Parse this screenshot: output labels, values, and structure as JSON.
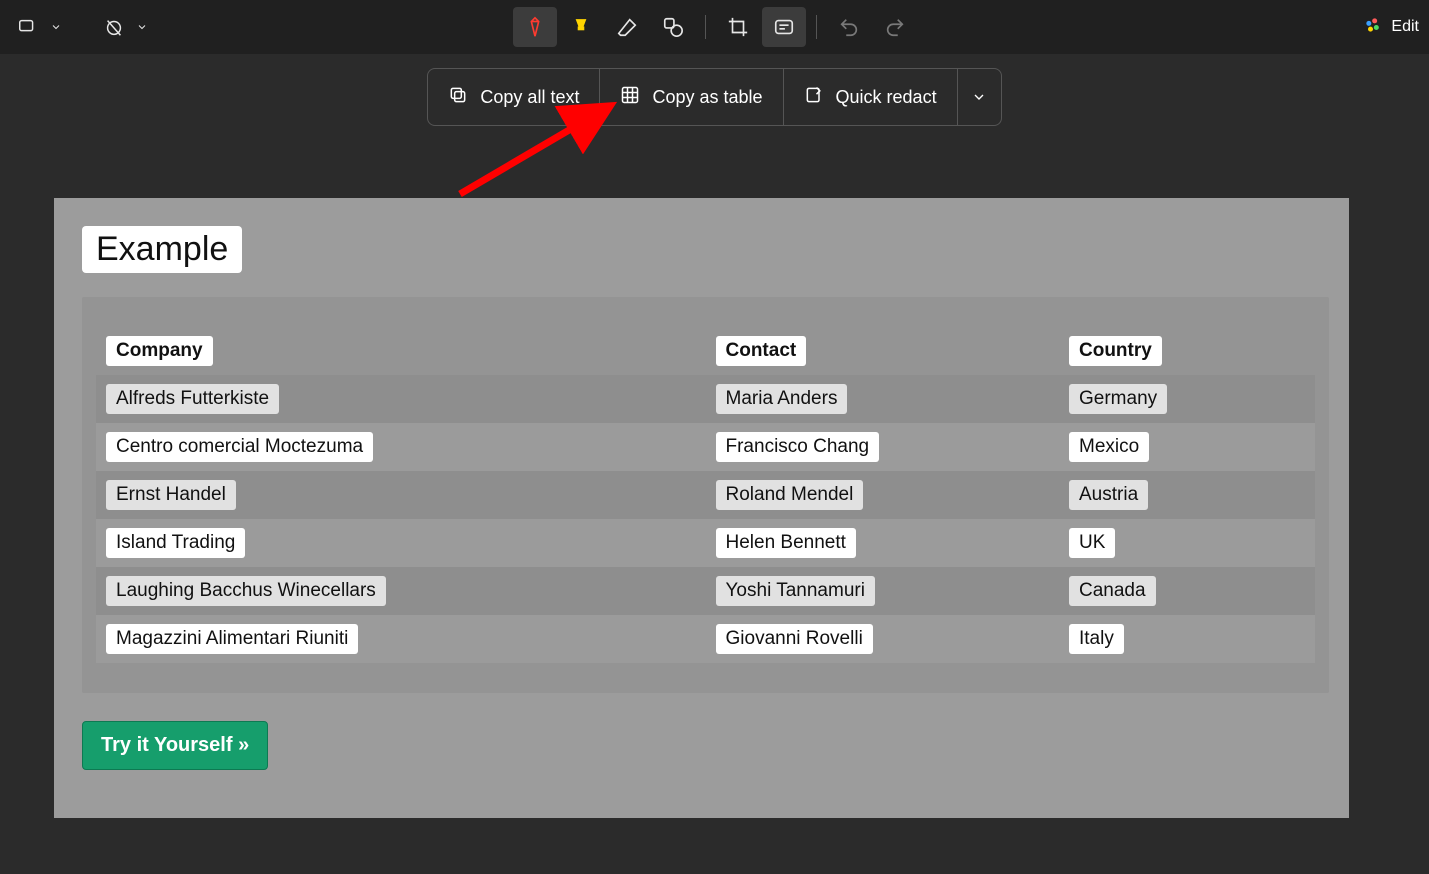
{
  "right": {
    "edit": "Edit"
  },
  "actions": {
    "copy_all": "Copy all text",
    "copy_table": "Copy as table",
    "quick_redact": "Quick redact"
  },
  "section_title": "Example",
  "table": {
    "headers": [
      "Company",
      "Contact",
      "Country"
    ],
    "rows": [
      [
        "Alfreds Futterkiste",
        "Maria Anders",
        "Germany"
      ],
      [
        "Centro comercial Moctezuma",
        "Francisco Chang",
        "Mexico"
      ],
      [
        "Ernst Handel",
        "Roland Mendel",
        "Austria"
      ],
      [
        "Island Trading",
        "Helen Bennett",
        "UK"
      ],
      [
        "Laughing Bacchus Winecellars",
        "Yoshi Tannamuri",
        "Canada"
      ],
      [
        "Magazzini Alimentari Riuniti",
        "Giovanni Rovelli",
        "Italy"
      ]
    ]
  },
  "try_btn": "Try it Yourself »"
}
